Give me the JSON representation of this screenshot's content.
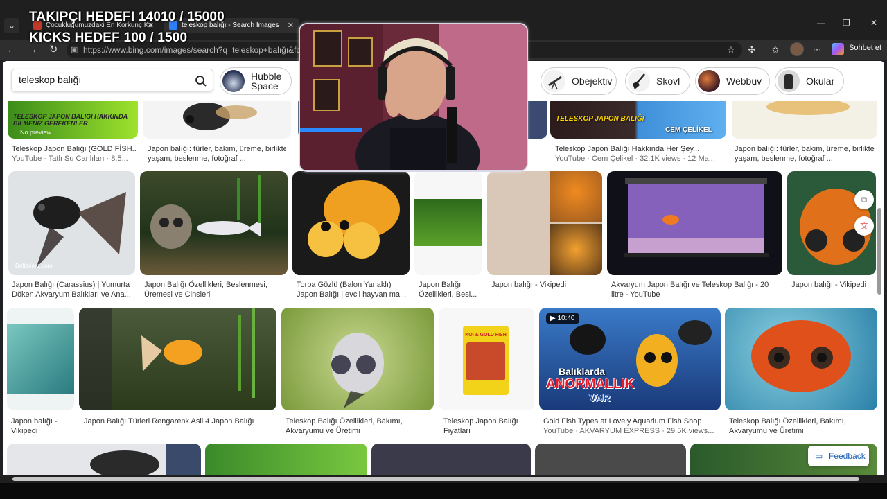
{
  "overlay": {
    "line1": "TAKIPÇI HEDEFI 14010 / 15000",
    "line2": "KICKS HEDEF 100 / 1500"
  },
  "tabs": [
    {
      "label": "Çocukluğumuzdaki En Korkunç Ka"
    },
    {
      "label": "teleskop balığı - Search Images"
    }
  ],
  "addressbar": {
    "url": "https://www.bing.com/images/search?q=teleskop+balığı&fo",
    "sohbet": "Sohbet et"
  },
  "search": {
    "query": "teleskop balığı"
  },
  "chips": [
    {
      "line1": "Hubble",
      "line2": "Space"
    },
    {
      "label": "Obejektiv"
    },
    {
      "label": "Skovl"
    },
    {
      "label": "Webbuv"
    },
    {
      "label": "Okular"
    }
  ],
  "row0": [
    {
      "title": "Teleskop Japon Balığı (GOLD FİSH...",
      "meta": "YouTube · Tatlı Su Canlıları · 8.5...",
      "overlay": "TELESKOP JAPON BALIGI HAKKINDA BILMENIZ GEREKENLER",
      "nopreview": "No preview"
    },
    {
      "title": "Japon balığı: türler, bakım, üreme, birlikte",
      "meta": "yaşam, beslenme, fotoğraf ..."
    },
    {
      "title": "Teleskop Japon Balığı Hakkında Her Şey...",
      "meta": "YouTube · Cem Çelikel · 32.1K views · 12 Ma...",
      "overlay": "TELESKOP JAPON BALIĞI",
      "overlay2": "CEM ÇELİKEL"
    },
    {
      "title": "Japon balığı: türler, bakım, üreme, birlikte",
      "meta": "yaşam, beslenme, fotoğraf ..."
    }
  ],
  "row1": [
    {
      "title": "Japon Balığı (Carassius) | Yumurta",
      "meta": "Döken Akvaryum Balıkları ve Ana...",
      "wm": "Defterimiz.com"
    },
    {
      "title": "Japon Balığı Özellikleri, Beslenmesi,",
      "meta": "Üremesi ve Cinsleri"
    },
    {
      "title": "Torba Gözlü (Balon Yanaklı)",
      "meta": "Japon Balığı | evcil hayvan ma..."
    },
    {
      "title": "Japon Balığı",
      "meta": "Özellikleri, Besl..."
    },
    {
      "title": "Japon balığı - Vikipedi",
      "meta": ""
    },
    {
      "title": "Akvaryum Japon Balığı ve Teleskop Balığı - 20",
      "meta": "litre - YouTube"
    },
    {
      "title": "Japon balığı - Vikipedi",
      "meta": ""
    }
  ],
  "row2": [
    {
      "title": "Japon balığı -",
      "meta": "Vikipedi"
    },
    {
      "title": "Japon Balığı Türleri Rengarenk Asil 4 Japon Balığı",
      "meta": ""
    },
    {
      "title": "Teleskop Balığı Özellikleri, Bakımı,",
      "meta": "Akvaryumu ve Üretimi"
    },
    {
      "title": "Teleskop Japon Balığı",
      "meta": "Fiyatları",
      "pack": "KOI & GOLD FISH"
    },
    {
      "title": "Gold Fish Types at Lovely Aquarium Fish Shop",
      "meta": "YouTube · AKVARYUM EXPRESS · 29.5K views...",
      "duration": "10:40",
      "overlay": "Balıklarda",
      "overlay2": "ANORMALLIK",
      "overlay3": "VAR"
    },
    {
      "title": "Teleskop Balığı Özellikleri, Bakımı,",
      "meta": "Akvaryumu ve Üretimi"
    }
  ],
  "feedback": "Feedback",
  "colors": {
    "chrome": "#1f1f1f",
    "accent": "#1a5fb4",
    "anomaly_red": "#e5192b"
  }
}
